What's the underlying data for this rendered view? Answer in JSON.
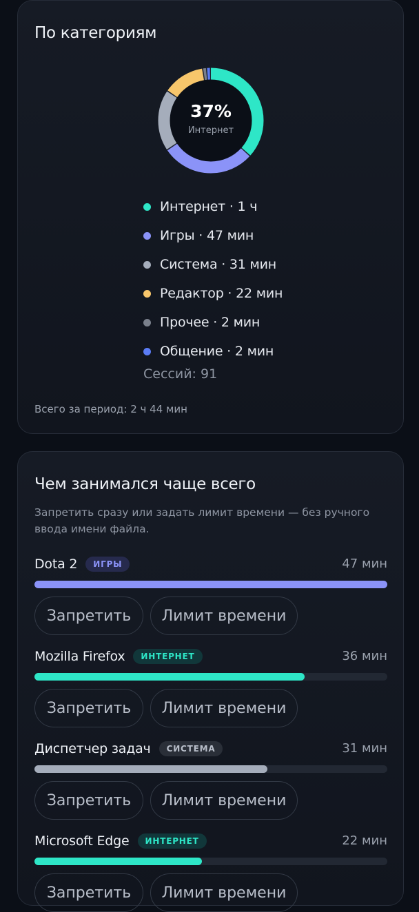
{
  "categories_card": {
    "title": "По категориям",
    "donut": {
      "percent": "37%",
      "label": "Интернет"
    },
    "legend": [
      {
        "text": "Интернет · 1 ч",
        "color": "#2ee6c7",
        "share": 0.37
      },
      {
        "text": "Игры · 47 мин",
        "color": "#8b93f8",
        "share": 0.29
      },
      {
        "text": "Система · 31 мин",
        "color": "#a5adbb",
        "share": 0.19
      },
      {
        "text": "Редактор · 22 мин",
        "color": "#f7c66b",
        "share": 0.13
      },
      {
        "text": "Прочее · 2 мин",
        "color": "#7a808c",
        "share": 0.012
      },
      {
        "text": "Общение · 2 мин",
        "color": "#5b7cf5",
        "share": 0.012
      }
    ],
    "sessions": "Сессий: 91",
    "total": "Всего за период: 2 ч 44 мин"
  },
  "top_card": {
    "title": "Чем занимался чаще всего",
    "subtitle": "Запретить сразу или задать лимит времени — без ручного ввода имени файла.",
    "ban_label": "Запретить",
    "limit_label": "Лимит времени",
    "apps": [
      {
        "name": "Dota 2",
        "badge": "ИГРЫ",
        "badge_color": "#8b93f8",
        "badge_bg": "#262a4d",
        "time": "47 мин",
        "progress": 1.0,
        "bar_color": "#8b93f8"
      },
      {
        "name": "Mozilla Firefox",
        "badge": "ИНТЕРНЕТ",
        "badge_color": "#2ee6c7",
        "badge_bg": "#11373a",
        "time": "36 мин",
        "progress": 0.766,
        "bar_color": "#2ee6c7"
      },
      {
        "name": "Диспетчер задач",
        "badge": "СИСТЕМА",
        "badge_color": "#b8bec9",
        "badge_bg": "#2a2f38",
        "time": "31 мин",
        "progress": 0.66,
        "bar_color": "#a5adbb"
      },
      {
        "name": "Microsoft Edge",
        "badge": "ИНТЕРНЕТ",
        "badge_color": "#2ee6c7",
        "badge_bg": "#11373a",
        "time": "22 мин",
        "progress": 0.475,
        "bar_color": "#2ee6c7"
      }
    ]
  }
}
